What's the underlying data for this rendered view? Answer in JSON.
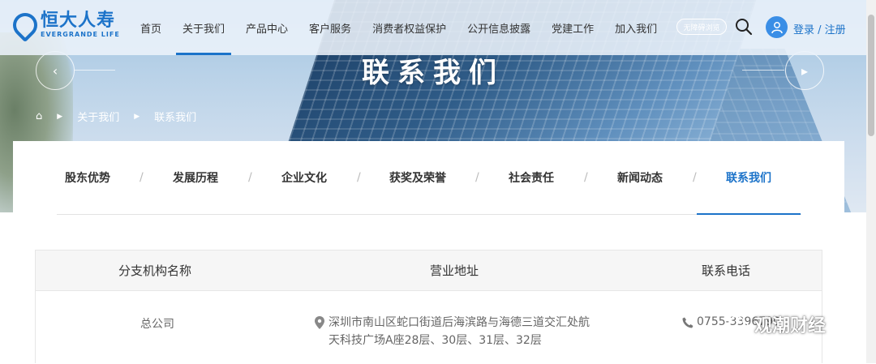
{
  "header": {
    "logo_cn": "恒大人寿",
    "logo_en": "EVERGRANDE LIFE",
    "nav": [
      {
        "label": "首页",
        "active": false
      },
      {
        "label": "关于我们",
        "active": true
      },
      {
        "label": "产品中心",
        "active": false
      },
      {
        "label": "客户服务",
        "active": false
      },
      {
        "label": "消费者权益保护",
        "active": false
      },
      {
        "label": "公开信息披露",
        "active": false
      },
      {
        "label": "党建工作",
        "active": false
      },
      {
        "label": "加入我们",
        "active": false
      }
    ],
    "barrier_free": "无障碍浏览",
    "login": "登录 / 注册"
  },
  "hero": {
    "title": "联系我们"
  },
  "breadcrumb": {
    "items": [
      "关于我们",
      "联系我们"
    ]
  },
  "tabs": [
    {
      "label": "股东优势",
      "active": false
    },
    {
      "label": "发展历程",
      "active": false
    },
    {
      "label": "企业文化",
      "active": false
    },
    {
      "label": "获奖及荣誉",
      "active": false
    },
    {
      "label": "社会责任",
      "active": false
    },
    {
      "label": "新闻动态",
      "active": false
    },
    {
      "label": "联系我们",
      "active": true
    }
  ],
  "table": {
    "headers": [
      "分支机构名称",
      "营业地址",
      "联系电话"
    ],
    "rows": [
      {
        "name": "总公司",
        "address_line1": "深圳市南山区蛇口街道后海滨路与海德三道交汇处航",
        "address_line2": "天科技广场A座28层、30层、31层、32层",
        "phone": "0755-3396790"
      }
    ]
  },
  "watermark": "观潮财经",
  "colors": {
    "accent": "#1c73c9"
  }
}
